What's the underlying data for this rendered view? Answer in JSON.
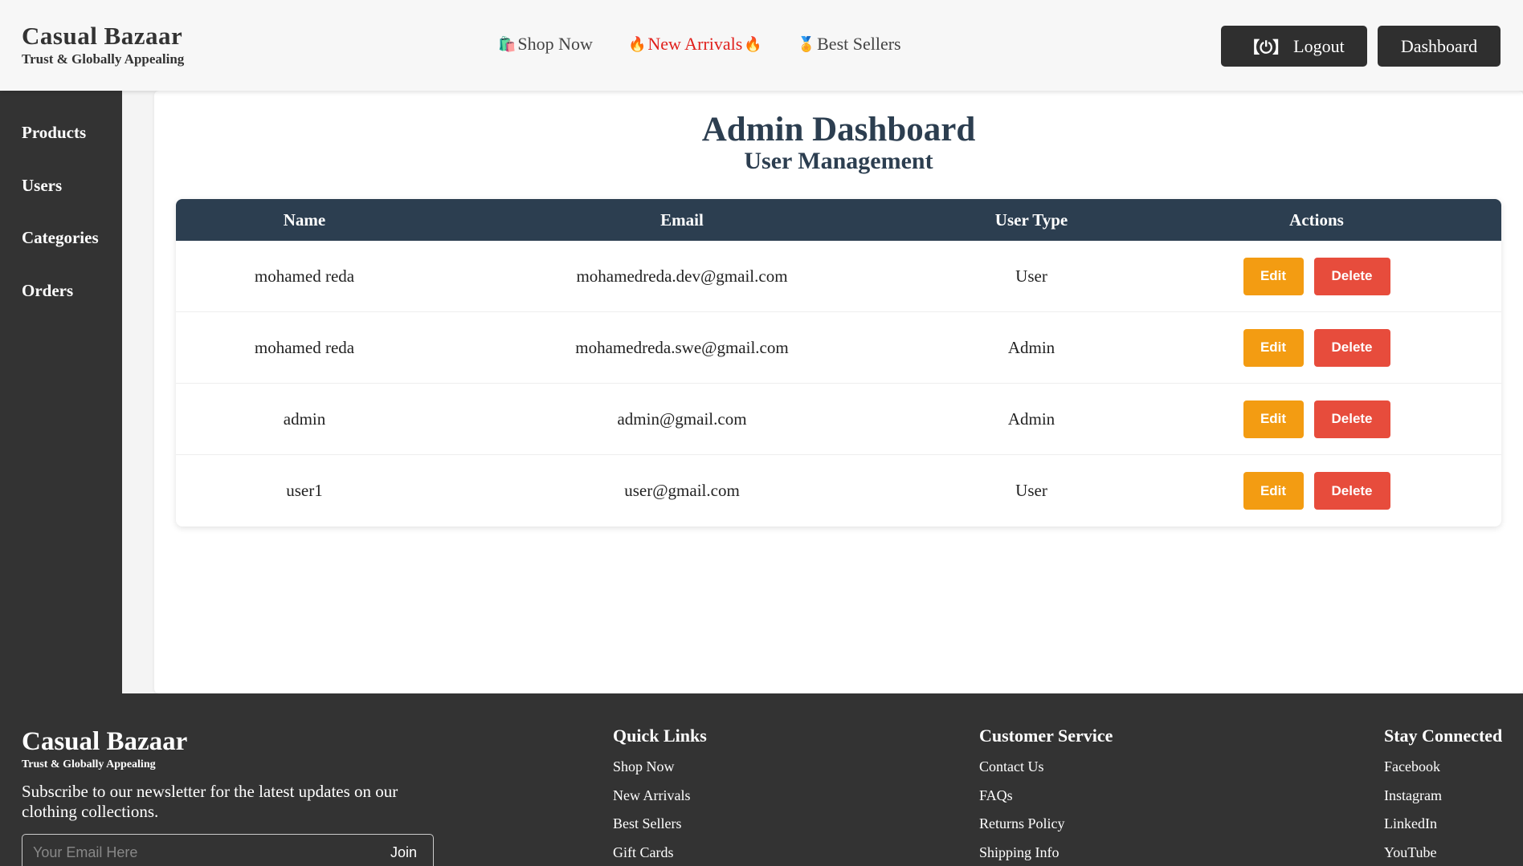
{
  "header": {
    "brand": "Casual Bazaar",
    "tagline": "Trust & Globally Appealing",
    "nav": {
      "shop_icon": "🛍️",
      "shop_label": "Shop Now",
      "fire_icon": "🔥",
      "arrivals_label": "New Arrivals",
      "medal_icon": "🏅",
      "best_label": "Best Sellers"
    },
    "logout_icon": "【⏻】",
    "logout_label": "Logout",
    "dashboard_label": "Dashboard"
  },
  "sidebar": {
    "items": [
      {
        "label": "Products"
      },
      {
        "label": "Users"
      },
      {
        "label": "Categories"
      },
      {
        "label": "Orders"
      }
    ]
  },
  "main": {
    "title": "Admin Dashboard",
    "subtitle": "User Management",
    "table": {
      "columns": [
        "Name",
        "Email",
        "User Type",
        "Actions"
      ],
      "rows": [
        {
          "name": "mohamed reda",
          "email": "mohamedreda.dev@gmail.com",
          "type": "User"
        },
        {
          "name": "mohamed reda",
          "email": "mohamedreda.swe@gmail.com",
          "type": "Admin"
        },
        {
          "name": "admin",
          "email": "admin@gmail.com",
          "type": "Admin"
        },
        {
          "name": "user1",
          "email": "user@gmail.com",
          "type": "User"
        }
      ],
      "edit_label": "Edit",
      "delete_label": "Delete"
    }
  },
  "footer": {
    "brand": "Casual Bazaar",
    "tagline": "Trust & Globally Appealing",
    "newsletter_text": "Subscribe to our newsletter for the latest updates on our clothing collections.",
    "email_placeholder": "Your Email Here",
    "join_label": "Join",
    "quick_links": {
      "title": "Quick Links",
      "items": [
        "Shop Now",
        "New Arrivals",
        "Best Sellers",
        "Gift Cards"
      ]
    },
    "customer_service": {
      "title": "Customer Service",
      "items": [
        "Contact Us",
        "FAQs",
        "Returns Policy",
        "Shipping Info"
      ]
    },
    "stay_connected": {
      "title": "Stay Connected",
      "items": [
        "Facebook",
        "Instagram",
        "LinkedIn",
        "YouTube"
      ]
    }
  },
  "colors": {
    "header_bg": "#f7f7f7",
    "dark": "#333333",
    "navy": "#2c3e50",
    "edit": "#f39c12",
    "delete": "#e74c3c",
    "hot_link": "#e0201c"
  }
}
